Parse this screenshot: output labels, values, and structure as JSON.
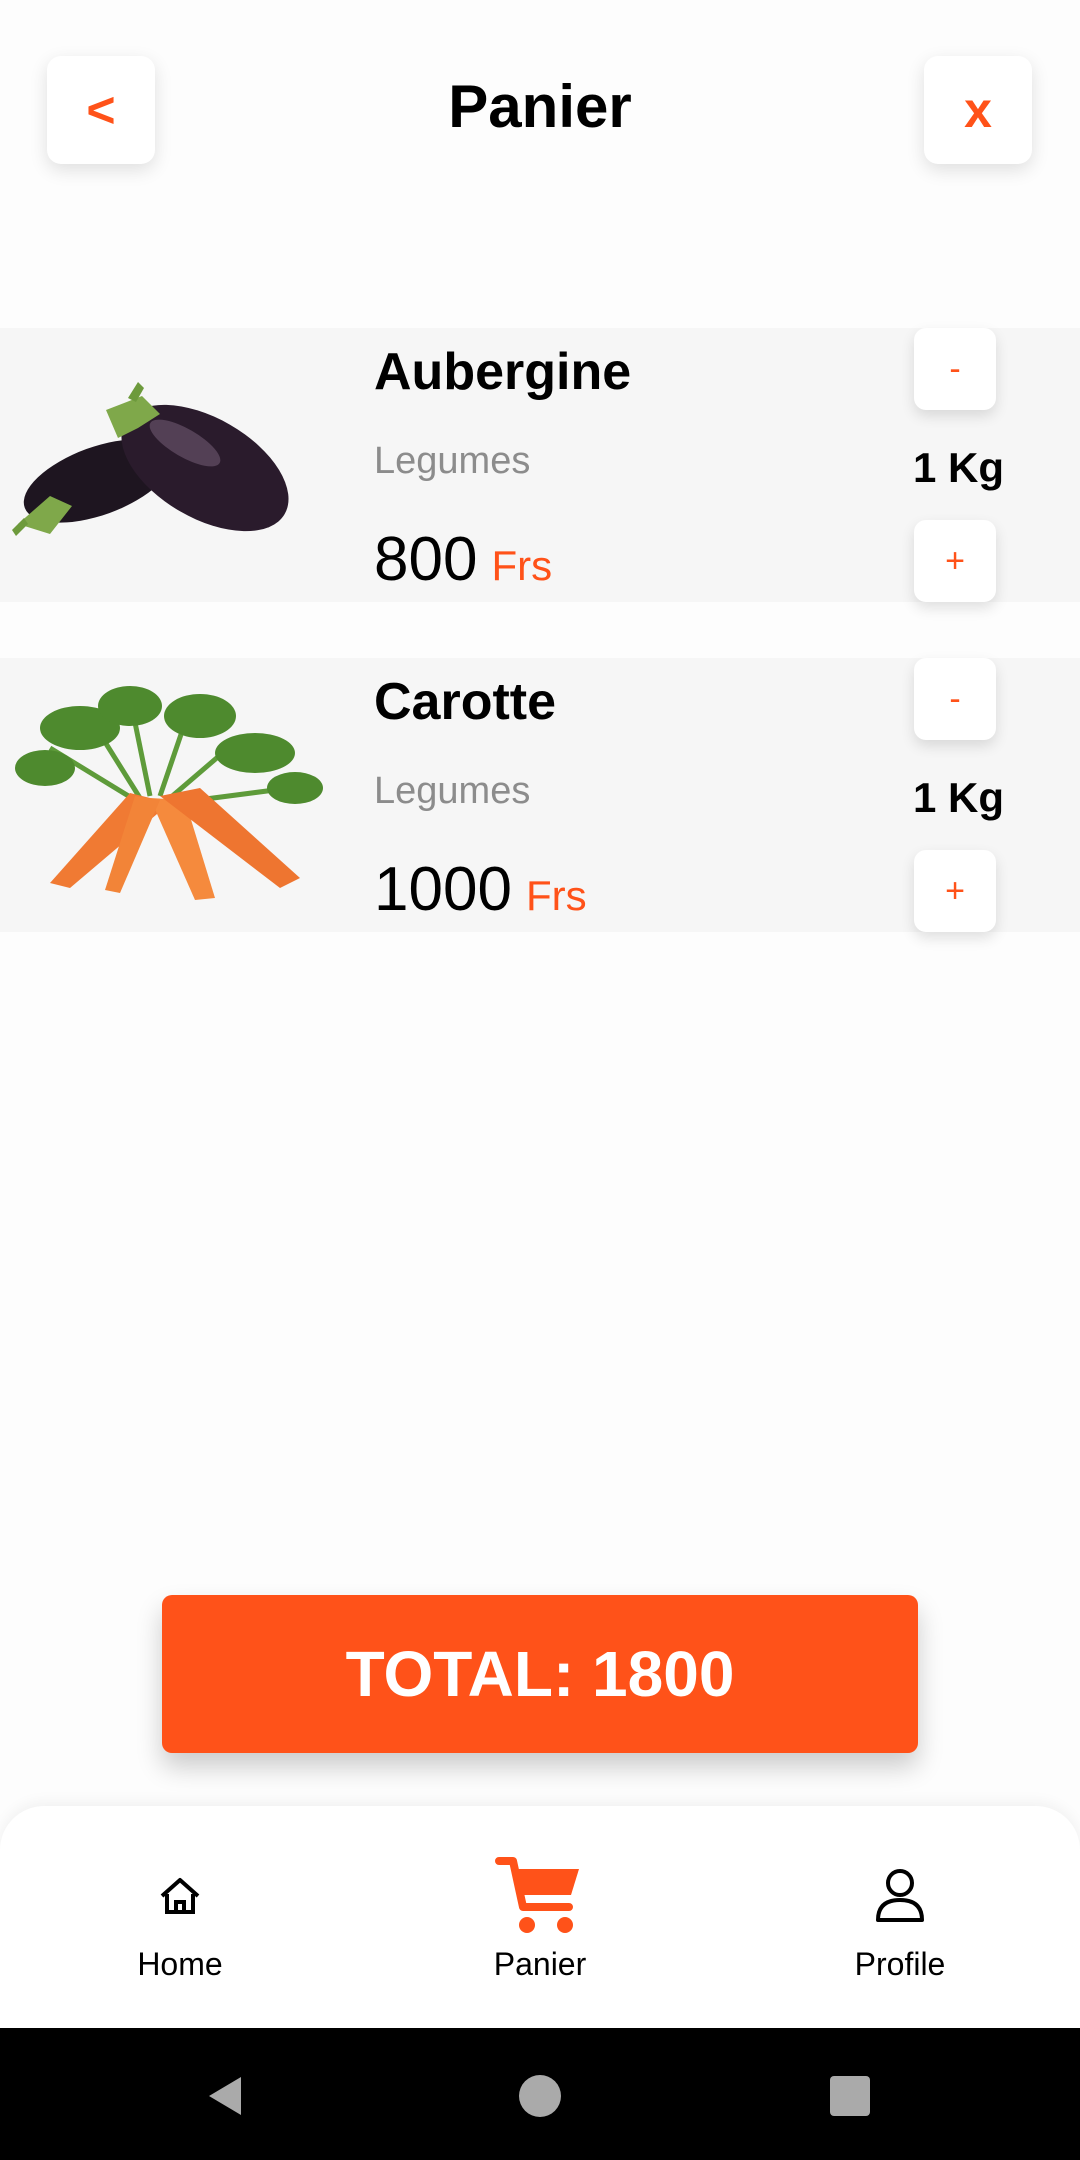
{
  "header": {
    "title": "Panier",
    "back_label": "<",
    "close_label": "x"
  },
  "cart": {
    "items": [
      {
        "name": "Aubergine",
        "category": "Legumes",
        "price": "800",
        "currency": "Frs",
        "quantity": "1 Kg",
        "minus_label": "-",
        "plus_label": "+",
        "image_icon": "aubergine-image"
      },
      {
        "name": "Carotte",
        "category": "Legumes",
        "price": "1000",
        "currency": "Frs",
        "quantity": "1 Kg",
        "minus_label": "-",
        "plus_label": "+",
        "image_icon": "carrot-image"
      }
    ]
  },
  "total": {
    "label": "TOTAL: 1800"
  },
  "bottom_nav": {
    "items": [
      {
        "label": "Home",
        "icon": "home-icon"
      },
      {
        "label": "Panier",
        "icon": "cart-icon",
        "active": true
      },
      {
        "label": "Profile",
        "icon": "profile-icon"
      }
    ]
  },
  "colors": {
    "accent": "#ff5219",
    "muted": "#8c8c8c",
    "item_bg": "#f6f6f6"
  }
}
